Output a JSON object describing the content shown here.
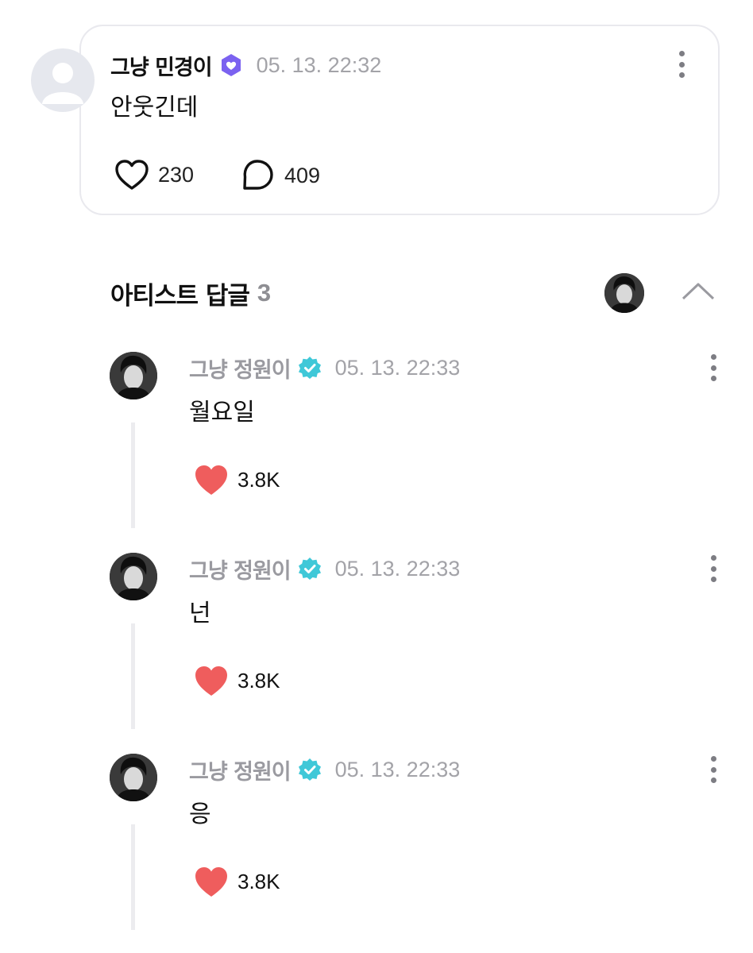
{
  "post": {
    "author": "그냥 민경이",
    "timestamp": "05. 13. 22:32",
    "text": "안웃긴데",
    "likes": "230",
    "comments": "409",
    "badge_icon": "fan-verified-heart-badge"
  },
  "artist_replies": {
    "title": "아티스트 답글",
    "count": "3",
    "collapse_icon": "chevron-up-icon"
  },
  "replies": [
    {
      "author": "그냥 정원이",
      "timestamp": "05. 13. 22:33",
      "text": "월요일",
      "likes": "3.8K"
    },
    {
      "author": "그냥 정원이",
      "timestamp": "05. 13. 22:33",
      "text": "넌",
      "likes": "3.8K"
    },
    {
      "author": "그냥 정원이",
      "timestamp": "05. 13. 22:33",
      "text": "응",
      "likes": "3.8K"
    }
  ],
  "colors": {
    "like_red": "#ef5d5d",
    "artist_badge": "#3fc8d8",
    "fan_badge": "#7b62f0"
  }
}
